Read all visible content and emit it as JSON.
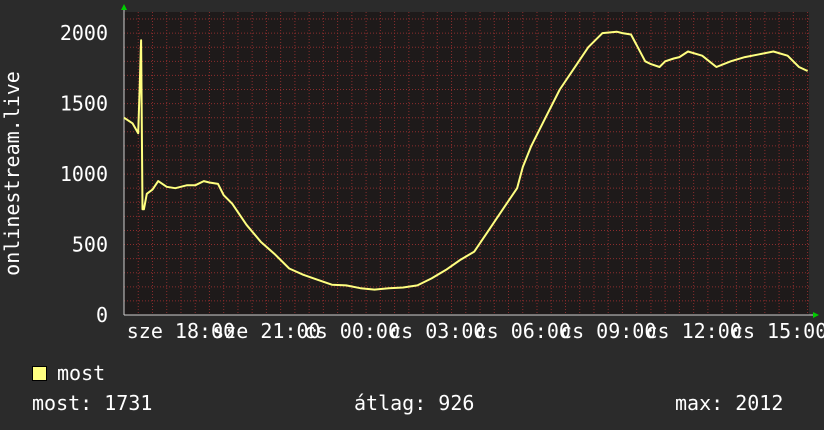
{
  "colors": {
    "background": "#2b2b2b",
    "plot_background": "#1e1a1a",
    "grid": "#8b2d2d",
    "line": "#ffff80",
    "axis_arrow": "#00cc00"
  },
  "chart_data": {
    "type": "line",
    "title": "",
    "ylabel": "onlinestream.live",
    "xlabel": "",
    "ylim": [
      0,
      2150
    ],
    "yticks": [
      0,
      500,
      1000,
      1500,
      2000
    ],
    "xlim_hours": [
      16.0,
      40.05
    ],
    "xtick_hours": [
      18,
      21,
      24,
      27,
      30,
      33,
      36,
      39
    ],
    "xtick_labels": [
      "sze 18:00",
      "sze 21:00",
      "cs 00:00",
      "cs 03:00",
      "cs 06:00",
      "cs 09:00",
      "cs 12:00",
      "cs 15:00"
    ],
    "grid": true,
    "series": [
      {
        "name": "most",
        "color": "#ffff80",
        "x": [
          16.0,
          16.3,
          16.5,
          16.55,
          16.6,
          16.65,
          16.7,
          16.8,
          17.0,
          17.2,
          17.5,
          17.8,
          18.2,
          18.5,
          18.8,
          19.0,
          19.3,
          19.5,
          19.8,
          20.3,
          20.8,
          21.3,
          21.8,
          22.3,
          22.8,
          23.3,
          23.8,
          24.3,
          24.8,
          25.3,
          25.8,
          26.3,
          26.8,
          27.3,
          27.8,
          28.3,
          28.8,
          29.3,
          29.8,
          30.0,
          30.3,
          30.8,
          31.3,
          31.8,
          32.3,
          32.8,
          33.3,
          33.5,
          33.8,
          34.3,
          34.5,
          34.8,
          35.0,
          35.3,
          35.5,
          35.8,
          36.3,
          36.8,
          37.3,
          37.8,
          38.3,
          38.8,
          39.3,
          39.7,
          40.0
        ],
        "values": [
          1400,
          1360,
          1290,
          1620,
          1950,
          750,
          750,
          860,
          890,
          950,
          910,
          900,
          920,
          920,
          950,
          940,
          930,
          850,
          790,
          640,
          520,
          430,
          330,
          285,
          250,
          215,
          210,
          190,
          180,
          190,
          195,
          210,
          260,
          320,
          390,
          450,
          600,
          750,
          900,
          1050,
          1200,
          1400,
          1600,
          1750,
          1900,
          2000,
          2010,
          2000,
          1990,
          1800,
          1780,
          1760,
          1800,
          1820,
          1830,
          1870,
          1840,
          1760,
          1800,
          1830,
          1850,
          1870,
          1840,
          1760,
          1731
        ]
      }
    ]
  },
  "legend": {
    "label": "most"
  },
  "stats": {
    "current_label": "most:",
    "current_value": "1731",
    "avg_label": "átlag:",
    "avg_value": "926",
    "max_label": "max:",
    "max_value": "2012"
  }
}
